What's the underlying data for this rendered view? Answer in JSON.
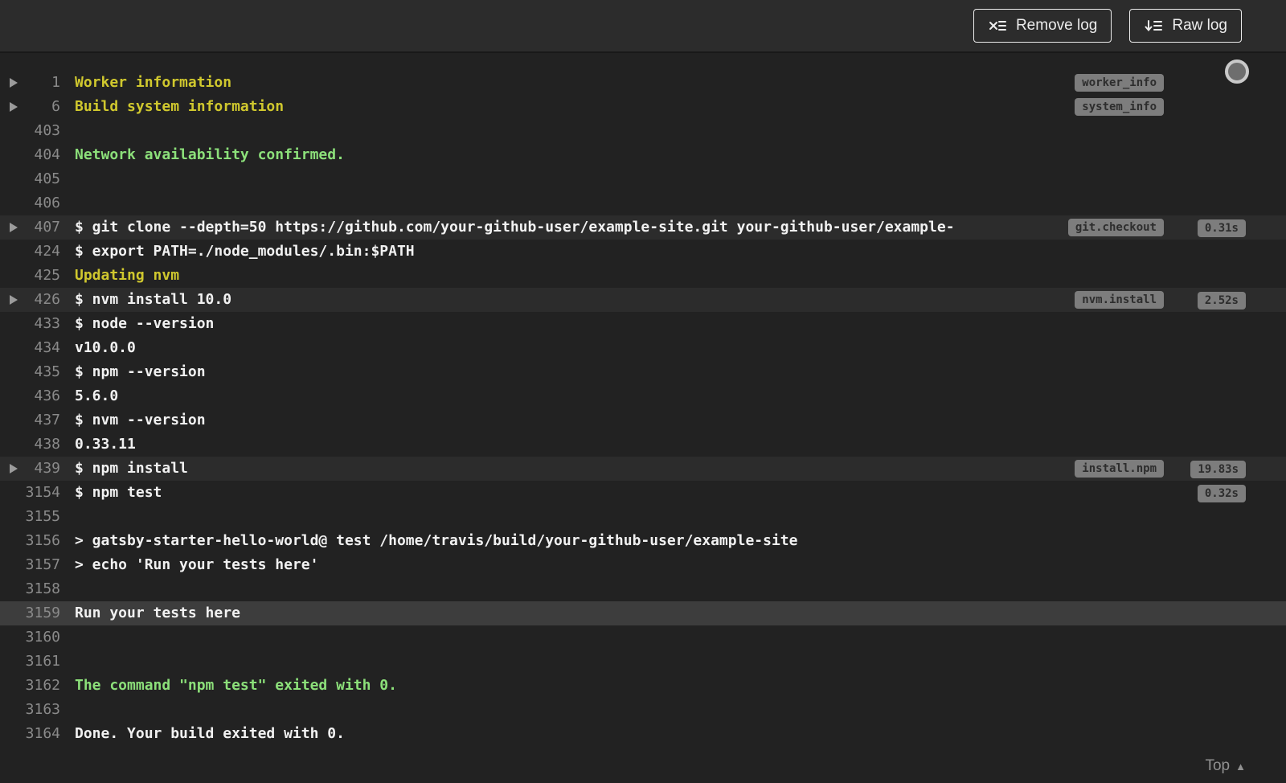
{
  "header": {
    "buttons": [
      {
        "label": "Remove log",
        "icon": "remove-log-icon"
      },
      {
        "label": "Raw log",
        "icon": "raw-log-icon"
      }
    ]
  },
  "colors": {
    "background": "#222222",
    "toolbar_background": "#2c2c2c",
    "yellow_text": "#d0c82e",
    "green_text": "#8ce07a",
    "pill_background": "#7d7d7d",
    "highlight_row": "#3d3d3d"
  },
  "log": {
    "lines": [
      {
        "n": "1",
        "text": "Worker information",
        "color": "yellow",
        "fold": true,
        "tag": "worker_info"
      },
      {
        "n": "6",
        "text": "Build system information",
        "color": "yellow",
        "fold": true,
        "tag": "system_info"
      },
      {
        "n": "403",
        "text": ""
      },
      {
        "n": "404",
        "text": "Network availability confirmed.",
        "color": "green"
      },
      {
        "n": "405",
        "text": ""
      },
      {
        "n": "406",
        "text": ""
      },
      {
        "n": "407",
        "text": "$ git clone --depth=50 https://github.com/your-github-user/example-site.git your-github-user/example-",
        "fold": true,
        "tag": "git.checkout",
        "duration": "0.31s",
        "highlight": "fold"
      },
      {
        "n": "424",
        "text": "$ export PATH=./node_modules/.bin:$PATH"
      },
      {
        "n": "425",
        "text": "Updating nvm",
        "color": "yellow"
      },
      {
        "n": "426",
        "text": "$ nvm install 10.0",
        "fold": true,
        "tag": "nvm.install",
        "duration": "2.52s",
        "highlight": "fold"
      },
      {
        "n": "433",
        "text": "$ node --version"
      },
      {
        "n": "434",
        "text": "v10.0.0"
      },
      {
        "n": "435",
        "text": "$ npm --version"
      },
      {
        "n": "436",
        "text": "5.6.0"
      },
      {
        "n": "437",
        "text": "$ nvm --version"
      },
      {
        "n": "438",
        "text": "0.33.11"
      },
      {
        "n": "439",
        "text": "$ npm install",
        "fold": true,
        "tag": "install.npm",
        "duration": "19.83s",
        "highlight": "fold"
      },
      {
        "n": "3154",
        "text": "$ npm test",
        "duration": "0.32s"
      },
      {
        "n": "3155",
        "text": ""
      },
      {
        "n": "3156",
        "text": "> gatsby-starter-hello-world@ test /home/travis/build/your-github-user/example-site"
      },
      {
        "n": "3157",
        "text": "> echo 'Run your tests here'"
      },
      {
        "n": "3158",
        "text": ""
      },
      {
        "n": "3159",
        "text": "Run your tests here",
        "highlight": "selected"
      },
      {
        "n": "3160",
        "text": ""
      },
      {
        "n": "3161",
        "text": ""
      },
      {
        "n": "3162",
        "text": "The command \"npm test\" exited with 0.",
        "color": "green"
      },
      {
        "n": "3163",
        "text": ""
      },
      {
        "n": "3164",
        "text": "Done. Your build exited with 0."
      }
    ]
  },
  "footer": {
    "top_label": "Top",
    "top_arrow": "▲"
  }
}
